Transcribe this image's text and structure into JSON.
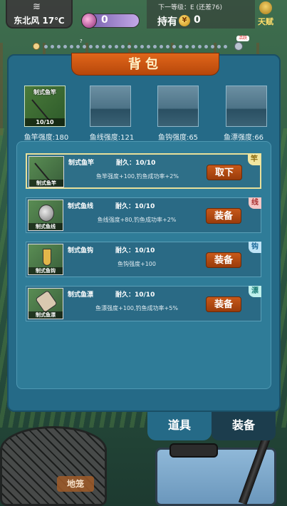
{
  "hud": {
    "weather": "东北风 17℃",
    "xp_value": "0",
    "next_level": "下一等级：E (还差76)",
    "hold_label": "持有",
    "hold_value": "0",
    "coin_glyph": "¥",
    "talent_label": "天赋",
    "progress_marker": "?",
    "progress_end_label": "活跃"
  },
  "backpack": {
    "title": "背包",
    "slots": [
      {
        "name": "制式鱼竿",
        "durability": "10/10",
        "filled": true
      },
      {
        "name": "",
        "durability": "",
        "filled": false
      },
      {
        "name": "",
        "durability": "",
        "filled": false
      },
      {
        "name": "",
        "durability": "",
        "filled": false
      }
    ],
    "stats": [
      "鱼竿强度:180",
      "鱼线强度:121",
      "鱼钩强度:65",
      "鱼漂强度:66"
    ],
    "items": [
      {
        "name": "制式鱼竿",
        "durability": "耐久：10/10",
        "desc": "鱼竿强度+100,钓鱼成功率+2%",
        "button": "取下",
        "tag": "竿",
        "tag_color": "#f2e6a0",
        "selected": true
      },
      {
        "name": "制式鱼线",
        "durability": "耐久：10/10",
        "desc": "鱼线强度+80,钓鱼成功率+2%",
        "button": "装备",
        "tag": "线",
        "tag_color": "#f4c6c6",
        "selected": false
      },
      {
        "name": "制式鱼钩",
        "durability": "耐久：10/10",
        "desc": "鱼钩强度+100",
        "button": "装备",
        "tag": "钩",
        "tag_color": "#bfe4f6",
        "selected": false
      },
      {
        "name": "制式鱼漂",
        "durability": "耐久：10/10",
        "desc": "鱼漂强度+100,钓鱼成功率+5%",
        "button": "装备",
        "tag": "漂",
        "tag_color": "#bff0ec",
        "selected": false
      }
    ]
  },
  "tabs": {
    "tools": "道具",
    "equipment": "装备"
  },
  "ground_label": "地笼"
}
